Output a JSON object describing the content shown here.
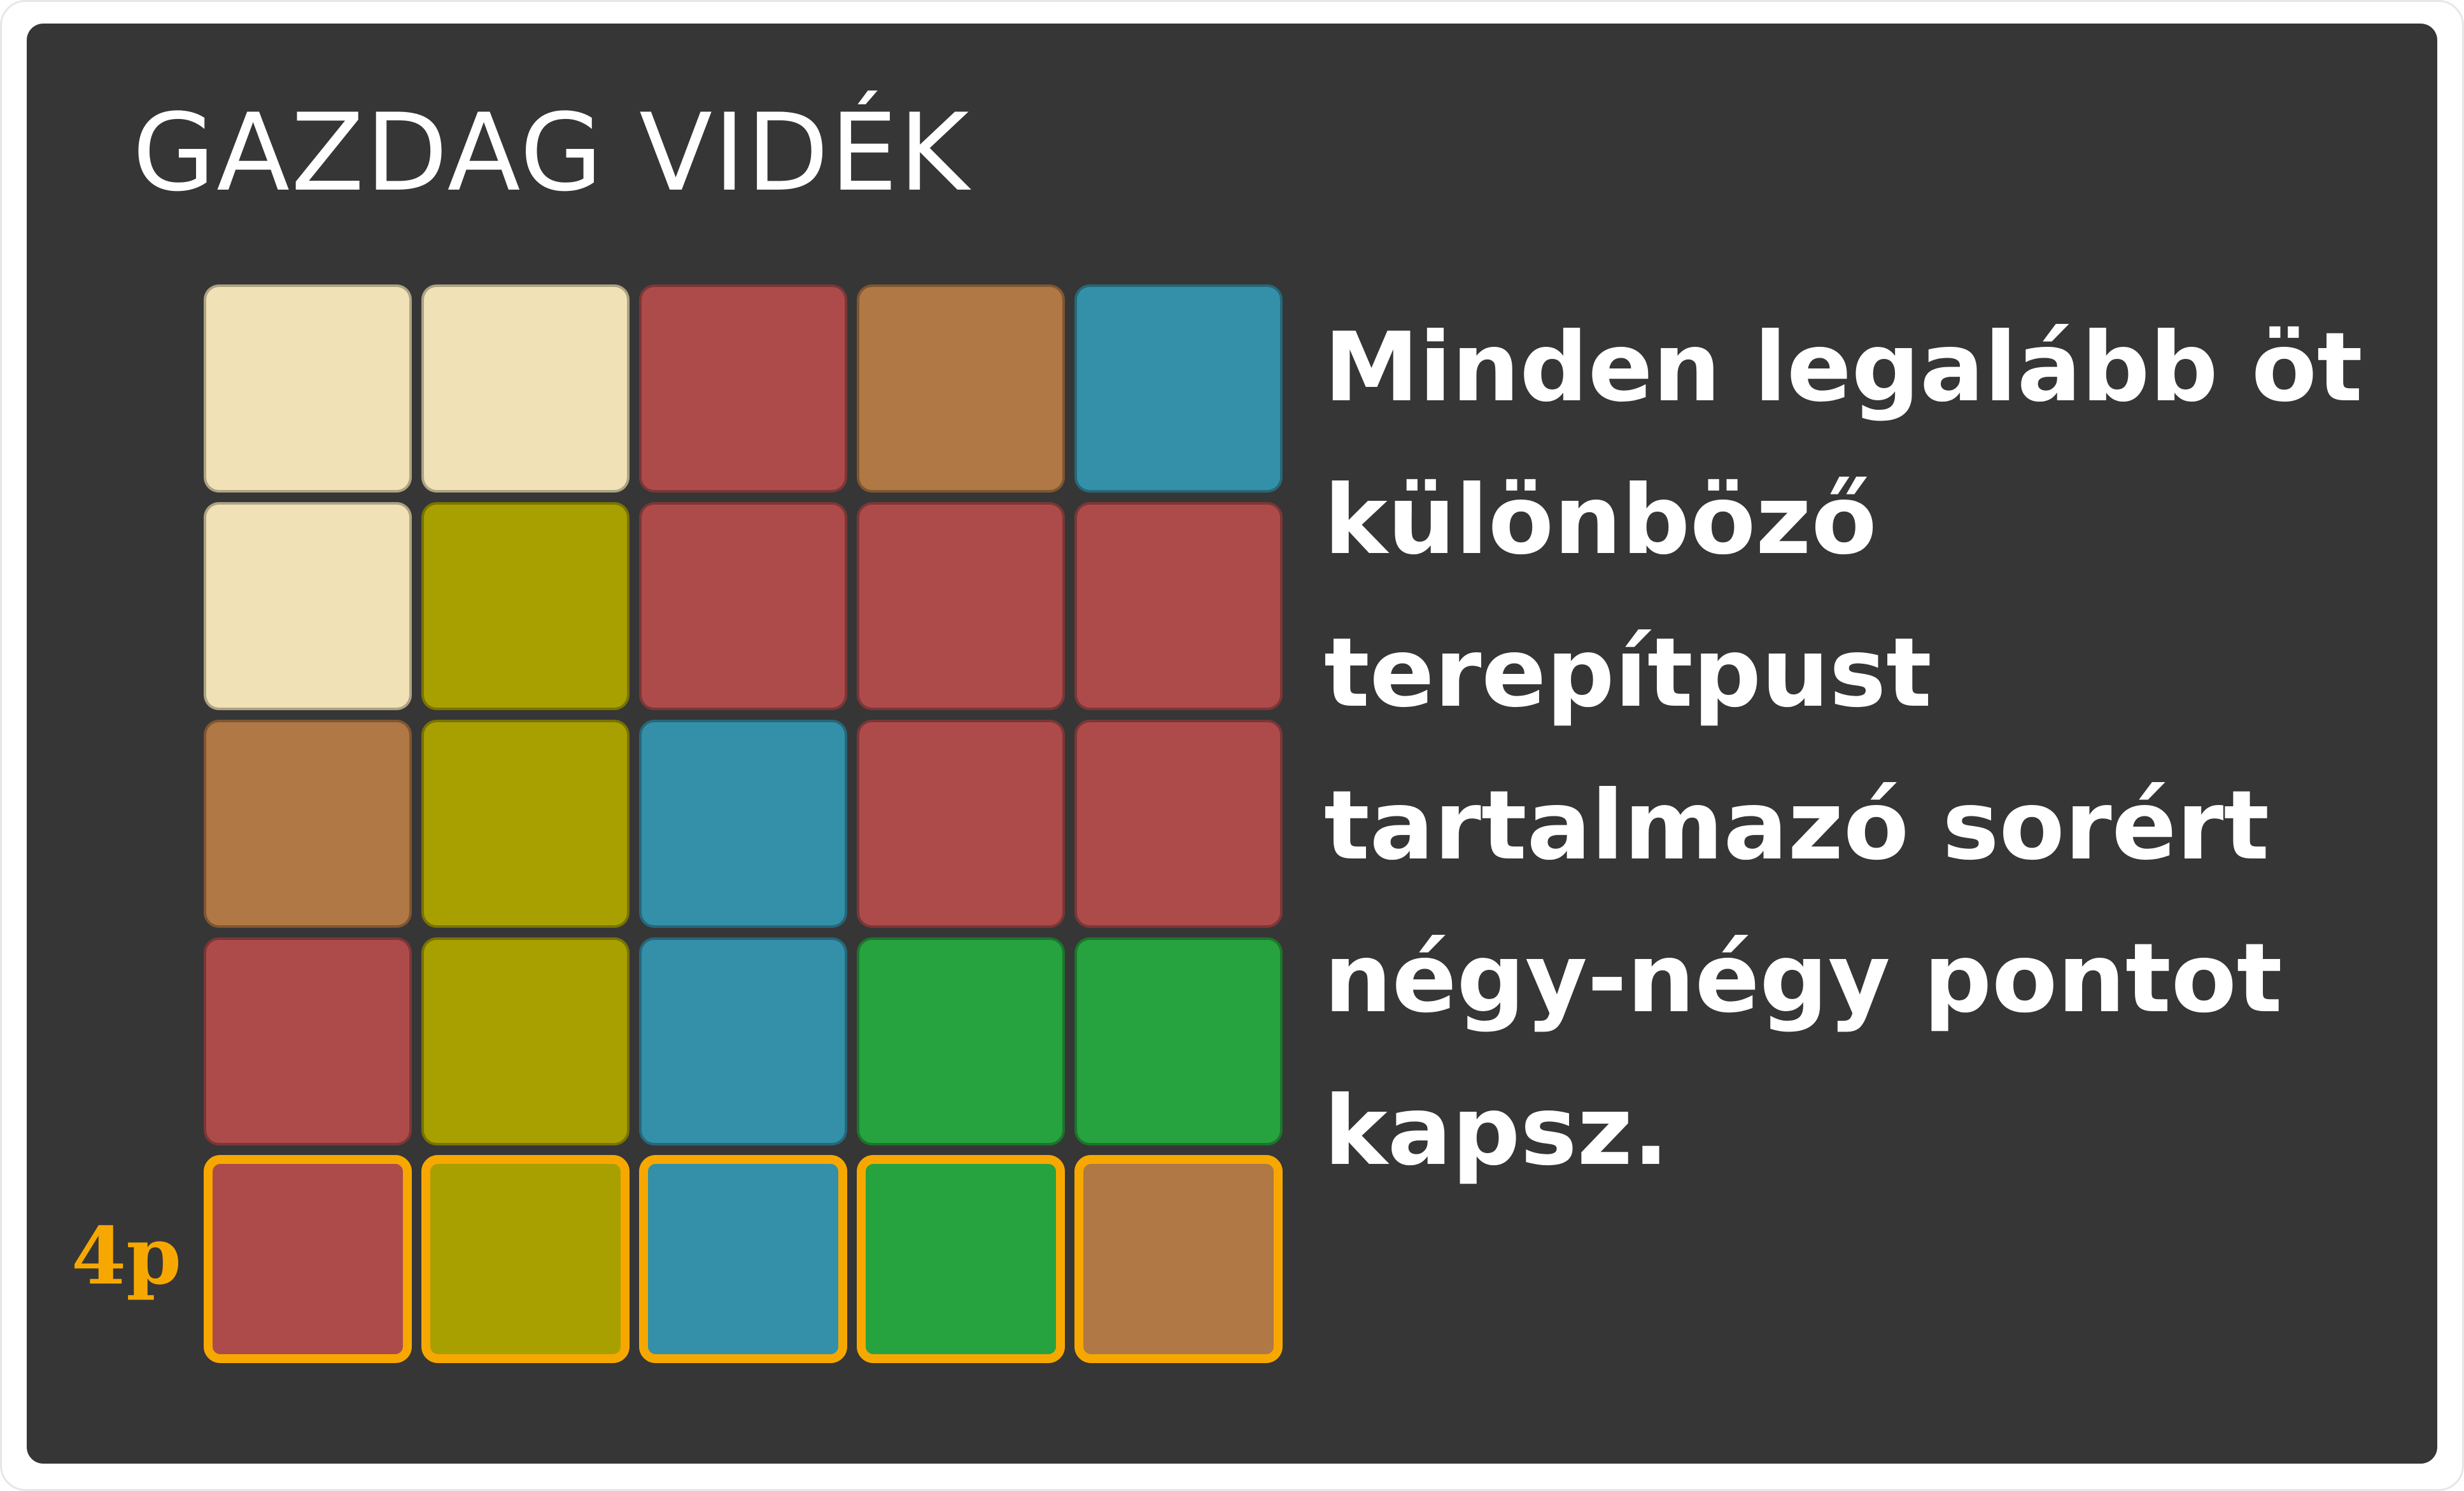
{
  "card": {
    "title": "GAZDAG VIDÉK",
    "description": "Minden legalább öt\nkülönböző\nterepítpust\ntartalmazó sorért\nnégy-négy pontot\nkapsz.",
    "score_label": "4p"
  },
  "colors": {
    "background": "#363636",
    "highlight": "#f7a800",
    "sand": "#f0e2b6",
    "red": "#ad4b4b",
    "brown": "#b07844",
    "blue": "#3490a8",
    "olive": "#a8a000",
    "green": "#26a33e"
  },
  "grid": {
    "rows": [
      [
        "sand",
        "sand",
        "red",
        "brown",
        "blue"
      ],
      [
        "sand",
        "olive",
        "red",
        "red",
        "red"
      ],
      [
        "brown",
        "olive",
        "blue",
        "red",
        "red"
      ],
      [
        "red",
        "olive",
        "blue",
        "green",
        "green"
      ],
      [
        "red",
        "olive",
        "blue",
        "green",
        "brown"
      ]
    ],
    "highlighted_row": 5
  }
}
